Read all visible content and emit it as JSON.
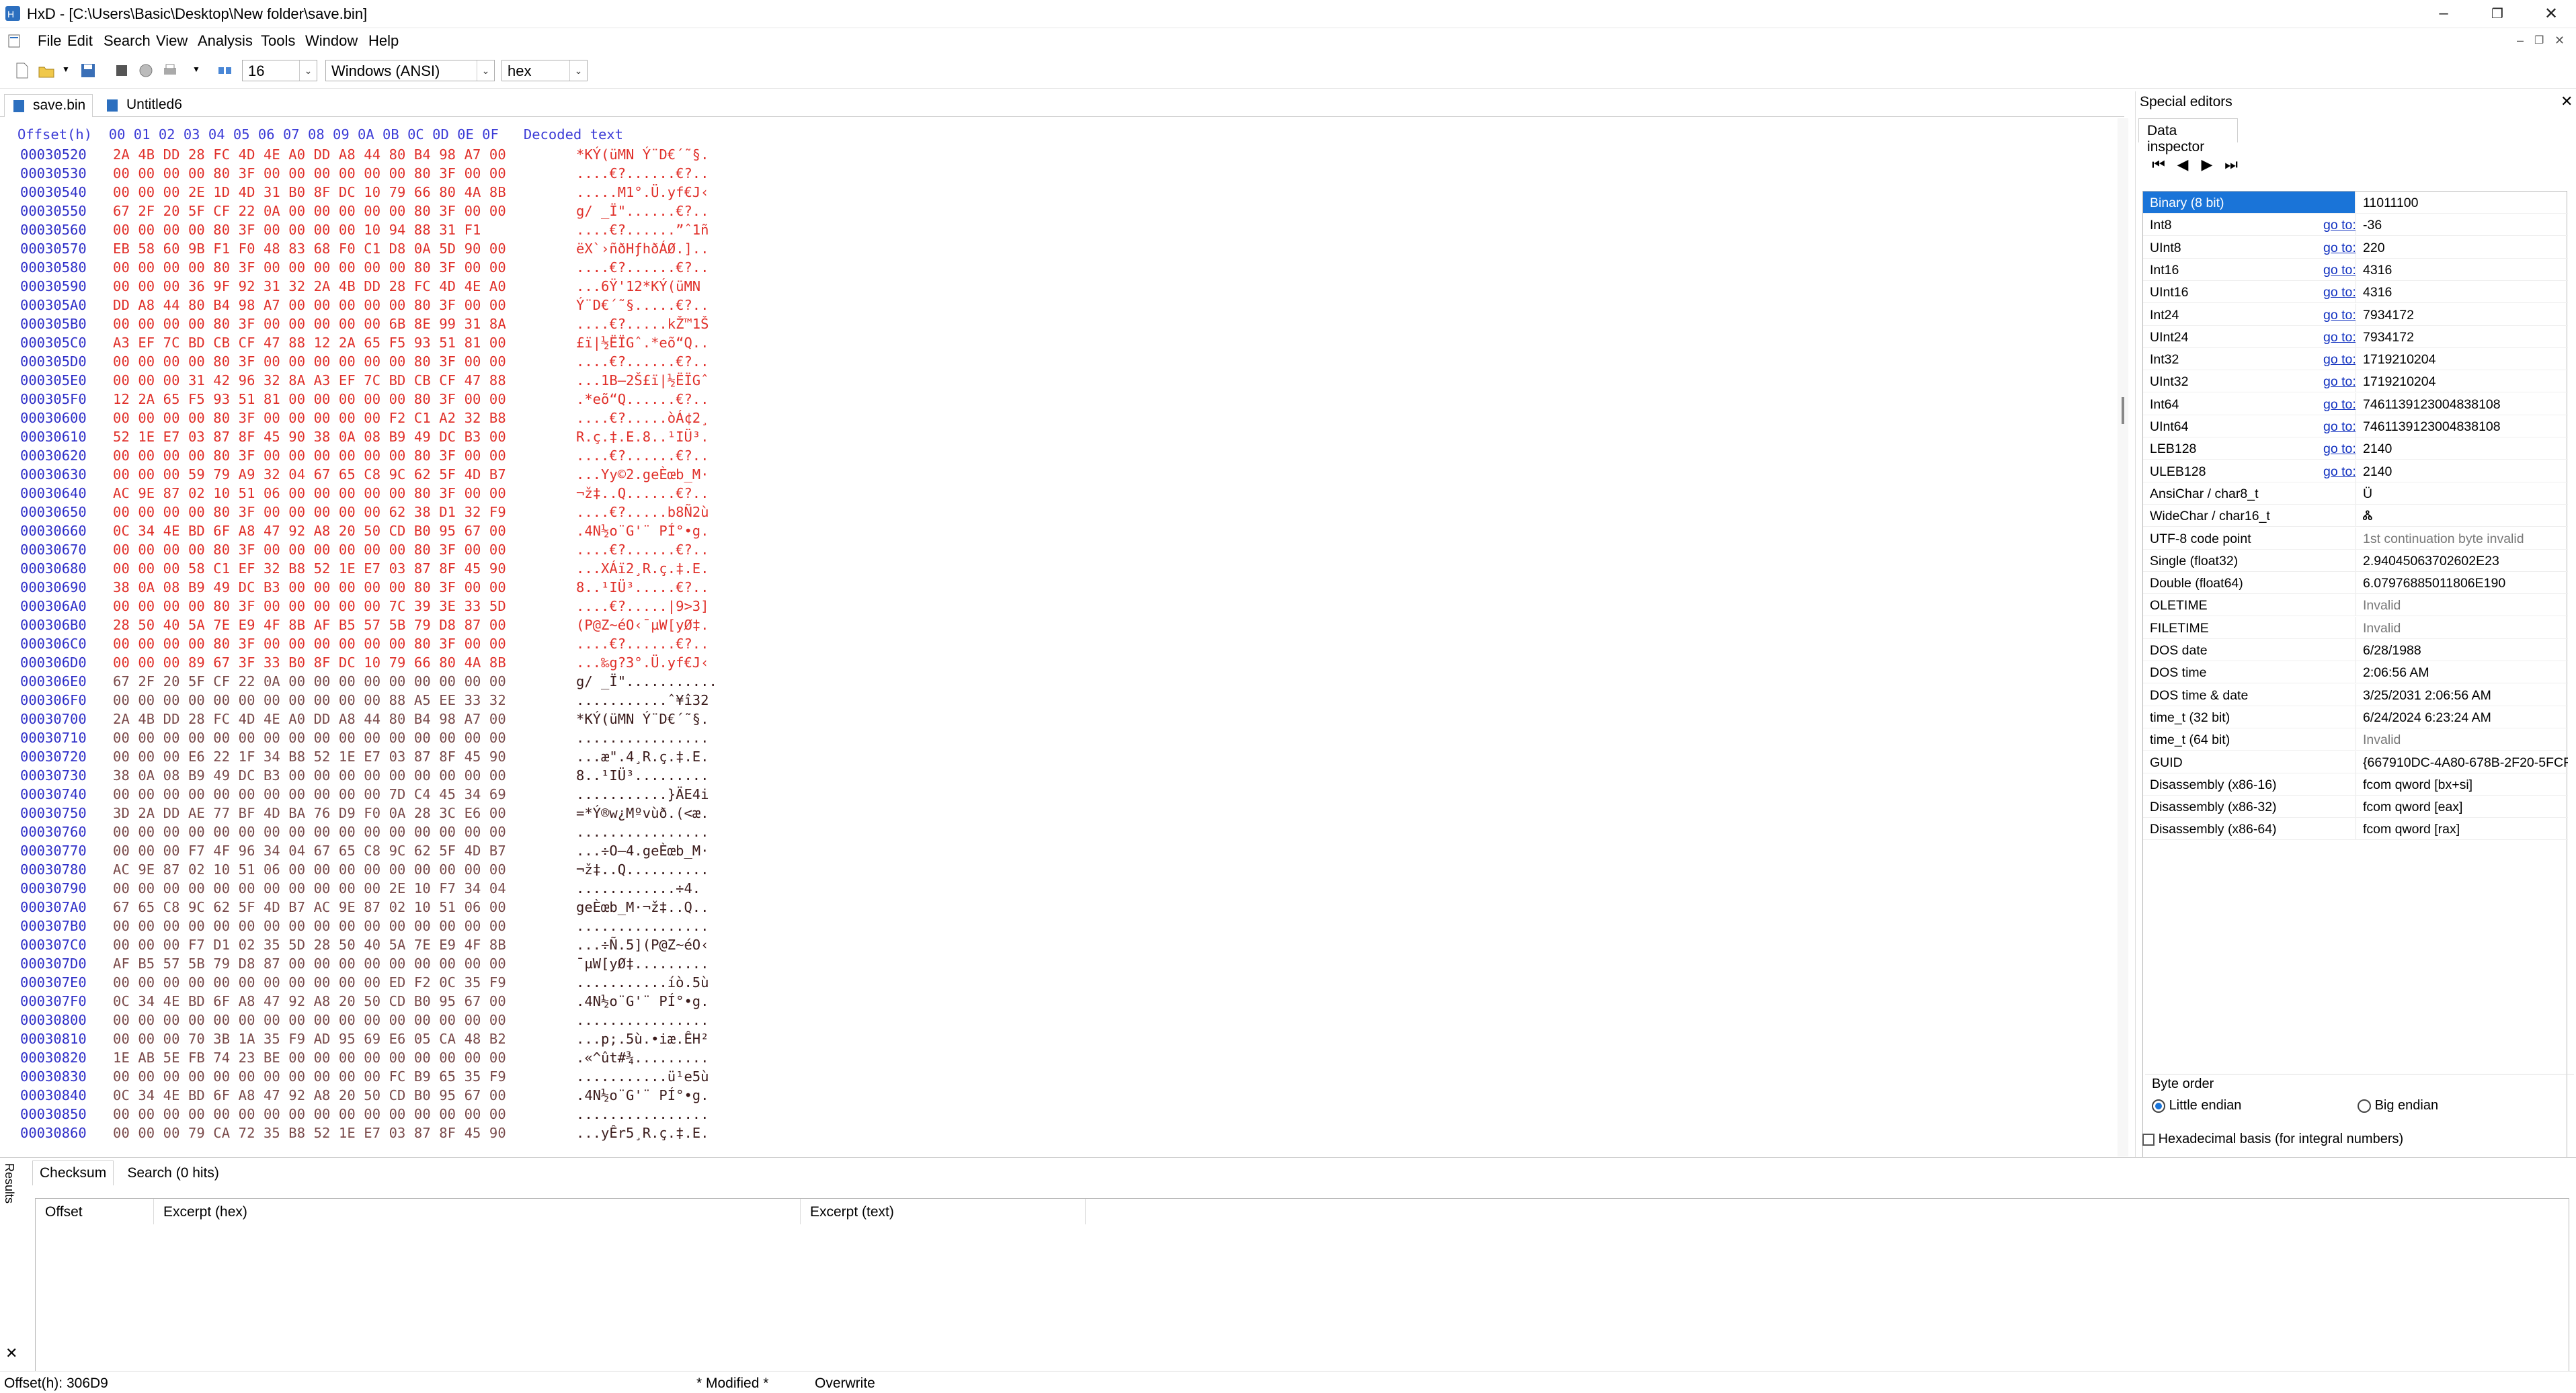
{
  "window": {
    "title": "HxD - [C:\\Users\\Basic\\Desktop\\New folder\\save.bin]",
    "controls": [
      "–",
      "❐",
      "✕"
    ],
    "mdi_controls": [
      "–",
      "❐",
      "✕"
    ]
  },
  "menu": [
    "File",
    "Edit",
    "Search",
    "View",
    "Analysis",
    "Tools",
    "Window",
    "Help"
  ],
  "toolbar": {
    "bytes_per_row": "16",
    "charset": "Windows (ANSI)",
    "display_mode": "hex"
  },
  "tabs": [
    "save.bin",
    "Untitled6"
  ],
  "hex_header": "Offset(h)  00 01 02 03 04 05 06 07 08 09 0A 0B 0C 0D 0E 0F   Decoded text",
  "hex_rows": [
    {
      "off": "00030520",
      "hex": "2A 4B DD 28 FC 4D 4E A0 DD A8 44 80 B4 98 A7 00",
      "txt": "*KÝ(üMN Ý¨D€´˜§."
    },
    {
      "off": "00030530",
      "hex": "00 00 00 00 80 3F 00 00 00 00 00 00 80 3F 00 00",
      "txt": "....€?......€?.."
    },
    {
      "off": "00030540",
      "hex": "00 00 00 2E 1D 4D 31 B0 8F DC 10 79 66 80 4A 8B",
      "txt": ".....M1°.Ü.yf€J‹"
    },
    {
      "off": "00030550",
      "hex": "67 2F 20 5F CF 22 0A 00 00 00 00 00 80 3F 00 00",
      "txt": "g/ _Ï\"......€?.."
    },
    {
      "off": "00030560",
      "hex": "00 00 00 00 80 3F 00 00 00 00 10 94 88 31 F1",
      "txt": "....€?......”ˆ1ñ"
    },
    {
      "off": "00030570",
      "hex": "EB 58 60 9B F1 F0 48 83 68 F0 C1 D8 0A 5D 90 00",
      "txt": "ëX`›ñðHƒhðÁØ.].."
    },
    {
      "off": "00030580",
      "hex": "00 00 00 00 80 3F 00 00 00 00 00 00 80 3F 00 00",
      "txt": "....€?......€?.."
    },
    {
      "off": "00030590",
      "hex": "00 00 00 36 9F 92 31 32 2A 4B DD 28 FC 4D 4E A0",
      "txt": "...6Ÿ'12*KÝ(üMN "
    },
    {
      "off": "000305A0",
      "hex": "DD A8 44 80 B4 98 A7 00 00 00 00 00 80 3F 00 00",
      "txt": "Ý¨D€´˜§.....€?.."
    },
    {
      "off": "000305B0",
      "hex": "00 00 00 00 80 3F 00 00 00 00 00 6B 8E 99 31 8A",
      "txt": "....€?.....kŽ™1Š"
    },
    {
      "off": "000305C0",
      "hex": "A3 EF 7C BD CB CF 47 88 12 2A 65 F5 93 51 81 00",
      "txt": "£ï|½ËÏGˆ.*eõ“Q.."
    },
    {
      "off": "000305D0",
      "hex": "00 00 00 00 80 3F 00 00 00 00 00 00 80 3F 00 00",
      "txt": "....€?......€?.."
    },
    {
      "off": "000305E0",
      "hex": "00 00 00 31 42 96 32 8A A3 EF 7C BD CB CF 47 88",
      "txt": "...1B–2Š£ï|½ËÏGˆ"
    },
    {
      "off": "000305F0",
      "hex": "12 2A 65 F5 93 51 81 00 00 00 00 00 80 3F 00 00",
      "txt": ".*eõ“Q......€?.."
    },
    {
      "off": "00030600",
      "hex": "00 00 00 00 80 3F 00 00 00 00 00 F2 C1 A2 32 B8",
      "txt": "....€?.....òÁ¢2¸"
    },
    {
      "off": "00030610",
      "hex": "52 1E E7 03 87 8F 45 90 38 0A 08 B9 49 DC B3 00",
      "txt": "R.ç.‡.E.8..¹IÜ³."
    },
    {
      "off": "00030620",
      "hex": "00 00 00 00 80 3F 00 00 00 00 00 00 80 3F 00 00",
      "txt": "....€?......€?.."
    },
    {
      "off": "00030630",
      "hex": "00 00 00 59 79 A9 32 04 67 65 C8 9C 62 5F 4D B7",
      "txt": "...Yy©2.geÈœb_M·"
    },
    {
      "off": "00030640",
      "hex": "AC 9E 87 02 10 51 06 00 00 00 00 00 80 3F 00 00",
      "txt": "¬ž‡..Q......€?.."
    },
    {
      "off": "00030650",
      "hex": "00 00 00 00 80 3F 00 00 00 00 00 62 38 D1 32 F9",
      "txt": "....€?.....b8Ñ2ù"
    },
    {
      "off": "00030660",
      "hex": "0C 34 4E BD 6F A8 47 92 A8 20 50 CD B0 95 67 00",
      "txt": ".4N½o¨G'¨ PÍ°•g."
    },
    {
      "off": "00030670",
      "hex": "00 00 00 00 80 3F 00 00 00 00 00 00 80 3F 00 00",
      "txt": "....€?......€?.."
    },
    {
      "off": "00030680",
      "hex": "00 00 00 58 C1 EF 32 B8 52 1E E7 03 87 8F 45 90",
      "txt": "...XÁï2¸R.ç.‡.E."
    },
    {
      "off": "00030690",
      "hex": "38 0A 08 B9 49 DC B3 00 00 00 00 00 80 3F 00 00",
      "txt": "8..¹IÜ³.....€?.."
    },
    {
      "off": "000306A0",
      "hex": "00 00 00 00 80 3F 00 00 00 00 00 7C 39 3E 33 5D",
      "txt": "....€?.....|9>3]"
    },
    {
      "off": "000306B0",
      "hex": "28 50 40 5A 7E E9 4F 8B AF B5 57 5B 79 D8 87 00",
      "txt": "(P@Z~éO‹¯µW[yØ‡."
    },
    {
      "off": "000306C0",
      "hex": "00 00 00 00 80 3F 00 00 00 00 00 00 80 3F 00 00",
      "txt": "....€?......€?.."
    },
    {
      "off": "000306D0",
      "hex": "00 00 00 89 67 3F 33 B0 8F DC 10 79 66 80 4A 8B",
      "txt": "...‰g?3°.Ü.yf€J‹"
    },
    {
      "off": "000306E0",
      "hex": "67 2F 20 5F CF 22 0A 00 00 00 00 00 00 00 00 00",
      "txt": "g/ _Ï\"..........."
    },
    {
      "off": "000306F0",
      "hex": "00 00 00 00 00 00 00 00 00 00 00 88 A5 EE 33 32",
      "txt": "...........ˆ¥î32"
    },
    {
      "off": "00030700",
      "hex": "2A 4B DD 28 FC 4D 4E A0 DD A8 44 80 B4 98 A7 00",
      "txt": "*KÝ(üMN Ý¨D€´˜§."
    },
    {
      "off": "00030710",
      "hex": "00 00 00 00 00 00 00 00 00 00 00 00 00 00 00 00",
      "txt": "................"
    },
    {
      "off": "00030720",
      "hex": "00 00 00 E6 22 1F 34 B8 52 1E E7 03 87 8F 45 90",
      "txt": "...æ\".4¸R.ç.‡.E."
    },
    {
      "off": "00030730",
      "hex": "38 0A 08 B9 49 DC B3 00 00 00 00 00 00 00 00 00",
      "txt": "8..¹IÜ³........."
    },
    {
      "off": "00030740",
      "hex": "00 00 00 00 00 00 00 00 00 00 00 7D C4 45 34 69",
      "txt": "...........}ÄE4i"
    },
    {
      "off": "00030750",
      "hex": "3D 2A DD AE 77 BF 4D BA 76 D9 F0 0A 28 3C E6 00",
      "txt": "=*Ý®w¿Mºvùð.(<æ."
    },
    {
      "off": "00030760",
      "hex": "00 00 00 00 00 00 00 00 00 00 00 00 00 00 00 00",
      "txt": "................"
    },
    {
      "off": "00030770",
      "hex": "00 00 00 F7 4F 96 34 04 67 65 C8 9C 62 5F 4D B7",
      "txt": "...÷O–4.geÈœb_M·"
    },
    {
      "off": "00030780",
      "hex": "AC 9E 87 02 10 51 06 00 00 00 00 00 00 00 00 00",
      "txt": "¬ž‡..Q.........."
    },
    {
      "off": "00030790",
      "hex": "00 00 00 00 00 00 00 00 00 00 00 2E 10 F7 34 04",
      "txt": "............÷4."
    },
    {
      "off": "000307A0",
      "hex": "67 65 C8 9C 62 5F 4D B7 AC 9E 87 02 10 51 06 00",
      "txt": "geÈœb_M·¬ž‡..Q.."
    },
    {
      "off": "000307B0",
      "hex": "00 00 00 00 00 00 00 00 00 00 00 00 00 00 00 00",
      "txt": "................"
    },
    {
      "off": "000307C0",
      "hex": "00 00 00 F7 D1 02 35 5D 28 50 40 5A 7E E9 4F 8B",
      "txt": "...÷Ñ.5](P@Z~éO‹"
    },
    {
      "off": "000307D0",
      "hex": "AF B5 57 5B 79 D8 87 00 00 00 00 00 00 00 00 00",
      "txt": "¯µW[yØ‡........."
    },
    {
      "off": "000307E0",
      "hex": "00 00 00 00 00 00 00 00 00 00 00 ED F2 0C 35 F9",
      "txt": "...........íò.5ù"
    },
    {
      "off": "000307F0",
      "hex": "0C 34 4E BD 6F A8 47 92 A8 20 50 CD B0 95 67 00",
      "txt": ".4N½o¨G'¨ PÍ°•g."
    },
    {
      "off": "00030800",
      "hex": "00 00 00 00 00 00 00 00 00 00 00 00 00 00 00 00",
      "txt": "................"
    },
    {
      "off": "00030810",
      "hex": "00 00 00 70 3B 1A 35 F9 AD 95 69 E6 05 CA 48 B2",
      "txt": "...p;.5ù.•iæ.ÊH²"
    },
    {
      "off": "00030820",
      "hex": "1E AB 5E FB 74 23 BE 00 00 00 00 00 00 00 00 00",
      "txt": ".«^ût#¾........."
    },
    {
      "off": "00030830",
      "hex": "00 00 00 00 00 00 00 00 00 00 00 FC B9 65 35 F9",
      "txt": "...........ü¹e5ù"
    },
    {
      "off": "00030840",
      "hex": "0C 34 4E BD 6F A8 47 92 A8 20 50 CD B0 95 67 00",
      "txt": ".4N½o¨G'¨ PÍ°•g."
    },
    {
      "off": "00030850",
      "hex": "00 00 00 00 00 00 00 00 00 00 00 00 00 00 00 00",
      "txt": "................"
    },
    {
      "off": "00030860",
      "hex": "00 00 00 79 CA 72 35 B8 52 1E E7 03 87 8F 45 90",
      "txt": "...yÊr5¸R.ç.‡.E."
    }
  ],
  "special_editors": {
    "header": "Special editors",
    "tab": "Data inspector",
    "goto_label": "go to:",
    "rows": [
      {
        "label": "Binary (8 bit)",
        "value": "11011100",
        "goto": false,
        "selected": true
      },
      {
        "label": "Int8",
        "value": "-36",
        "goto": true
      },
      {
        "label": "UInt8",
        "value": "220",
        "goto": true
      },
      {
        "label": "Int16",
        "value": "4316",
        "goto": true
      },
      {
        "label": "UInt16",
        "value": "4316",
        "goto": true
      },
      {
        "label": "Int24",
        "value": "7934172",
        "goto": true
      },
      {
        "label": "UInt24",
        "value": "7934172",
        "goto": true
      },
      {
        "label": "Int32",
        "value": "1719210204",
        "goto": true
      },
      {
        "label": "UInt32",
        "value": "1719210204",
        "goto": true
      },
      {
        "label": "Int64",
        "value": "7461139123004838108",
        "goto": true
      },
      {
        "label": "UInt64",
        "value": "7461139123004838108",
        "goto": true
      },
      {
        "label": "LEB128",
        "value": "2140",
        "goto": true
      },
      {
        "label": "ULEB128",
        "value": "2140",
        "goto": true
      },
      {
        "label": "AnsiChar / char8_t",
        "value": "Ü",
        "goto": false
      },
      {
        "label": "WideChar / char16_t",
        "value": "Ꮬ",
        "goto": false
      },
      {
        "label": "UTF-8 code point",
        "value": "1st continuation byte invalid",
        "goto": false,
        "grey": true
      },
      {
        "label": "Single (float32)",
        "value": "2.94045063702602E23",
        "goto": false
      },
      {
        "label": "Double (float64)",
        "value": "6.07976885011806E190",
        "goto": false
      },
      {
        "label": "OLETIME",
        "value": "Invalid",
        "goto": false,
        "grey": true
      },
      {
        "label": "FILETIME",
        "value": "Invalid",
        "goto": false,
        "grey": true
      },
      {
        "label": "DOS date",
        "value": "6/28/1988",
        "goto": false
      },
      {
        "label": "DOS time",
        "value": "2:06:56 AM",
        "goto": false
      },
      {
        "label": "DOS time & date",
        "value": "3/25/2031 2:06:56 AM",
        "goto": false
      },
      {
        "label": "time_t (32 bit)",
        "value": "6/24/2024 6:23:24 AM",
        "goto": false
      },
      {
        "label": "time_t (64 bit)",
        "value": "Invalid",
        "goto": false,
        "grey": true
      },
      {
        "label": "GUID",
        "value": "{667910DC-4A80-678B-2F20-5FCF",
        "goto": false
      },
      {
        "label": "Disassembly (x86-16)",
        "value": "fcom qword [bx+si]",
        "goto": false
      },
      {
        "label": "Disassembly (x86-32)",
        "value": "fcom qword [eax]",
        "goto": false
      },
      {
        "label": "Disassembly (x86-64)",
        "value": "fcom qword [rax]",
        "goto": false
      }
    ],
    "byte_order_label": "Byte order",
    "little_endian": "Little endian",
    "big_endian": "Big endian",
    "hex_basis": "Hexadecimal basis (for integral numbers)"
  },
  "results": {
    "side_label": "Results",
    "tabs": [
      "Checksum",
      "Search (0 hits)"
    ],
    "columns": [
      "Offset",
      "Excerpt (hex)",
      "Excerpt (text)"
    ]
  },
  "status": {
    "offset": "Offset(h): 306D9",
    "modified": "* Modified *",
    "mode": "Overwrite"
  },
  "colors": {
    "modified_text": "#e0302a",
    "offset_text": "#3030c8",
    "selection": "#1a74d8"
  }
}
